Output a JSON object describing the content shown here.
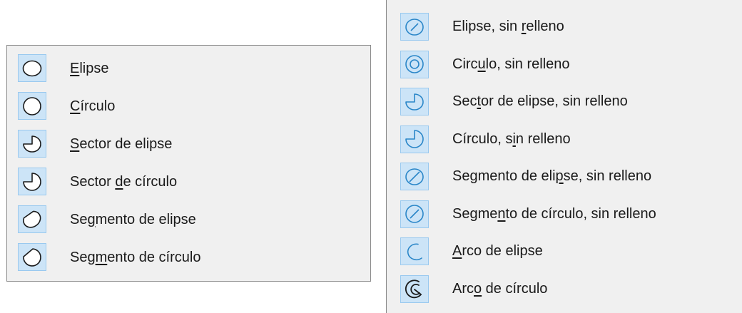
{
  "left_menu": {
    "items": [
      {
        "pre": "",
        "key": "E",
        "post": "lipse",
        "icon": "ellipse-icon"
      },
      {
        "pre": "",
        "key": "C",
        "post": "írculo",
        "icon": "circle-icon"
      },
      {
        "pre": "",
        "key": "S",
        "post": "ector de elipse",
        "icon": "ellipse-sector-icon"
      },
      {
        "pre": "Sector ",
        "key": "d",
        "post": "e círculo",
        "icon": "circle-sector-icon"
      },
      {
        "pre": "Se",
        "key": "g",
        "post": "mento de elipse",
        "icon": "ellipse-segment-icon"
      },
      {
        "pre": "Seg",
        "key": "m",
        "post": "ento de círculo",
        "icon": "circle-segment-icon"
      }
    ]
  },
  "right_menu": {
    "items": [
      {
        "pre": "Elipse, sin ",
        "key": "r",
        "post": "elleno",
        "icon": "ellipse-unfilled-icon"
      },
      {
        "pre": "Circ",
        "key": "u",
        "post": "lo, sin relleno",
        "icon": "circle-unfilled-icon"
      },
      {
        "pre": "Sec",
        "key": "t",
        "post": "or de elipse, sin relleno",
        "icon": "ellipse-sector-unfilled-icon"
      },
      {
        "pre": "Círculo, s",
        "key": "i",
        "post": "n relleno",
        "icon": "circle-sector-unfilled-icon"
      },
      {
        "pre": "Segmento de eli",
        "key": "p",
        "post": "se, sin relleno",
        "icon": "ellipse-segment-unfilled-icon"
      },
      {
        "pre": "Segme",
        "key": "n",
        "post": "to de círculo, sin relleno",
        "icon": "circle-segment-unfilled-icon"
      },
      {
        "pre": "",
        "key": "A",
        "post": "rco de elipse",
        "icon": "ellipse-arc-icon"
      },
      {
        "pre": "Arc",
        "key": "o",
        "post": " de círculo",
        "icon": "circle-arc-icon"
      }
    ]
  },
  "colors": {
    "menu_bg": "#f0f0f0",
    "icon_bg": "#cce4f7",
    "icon_border": "#99c9ef",
    "filled_stroke": "#1a1a1a",
    "unfilled_stroke": "#2a86c8"
  }
}
